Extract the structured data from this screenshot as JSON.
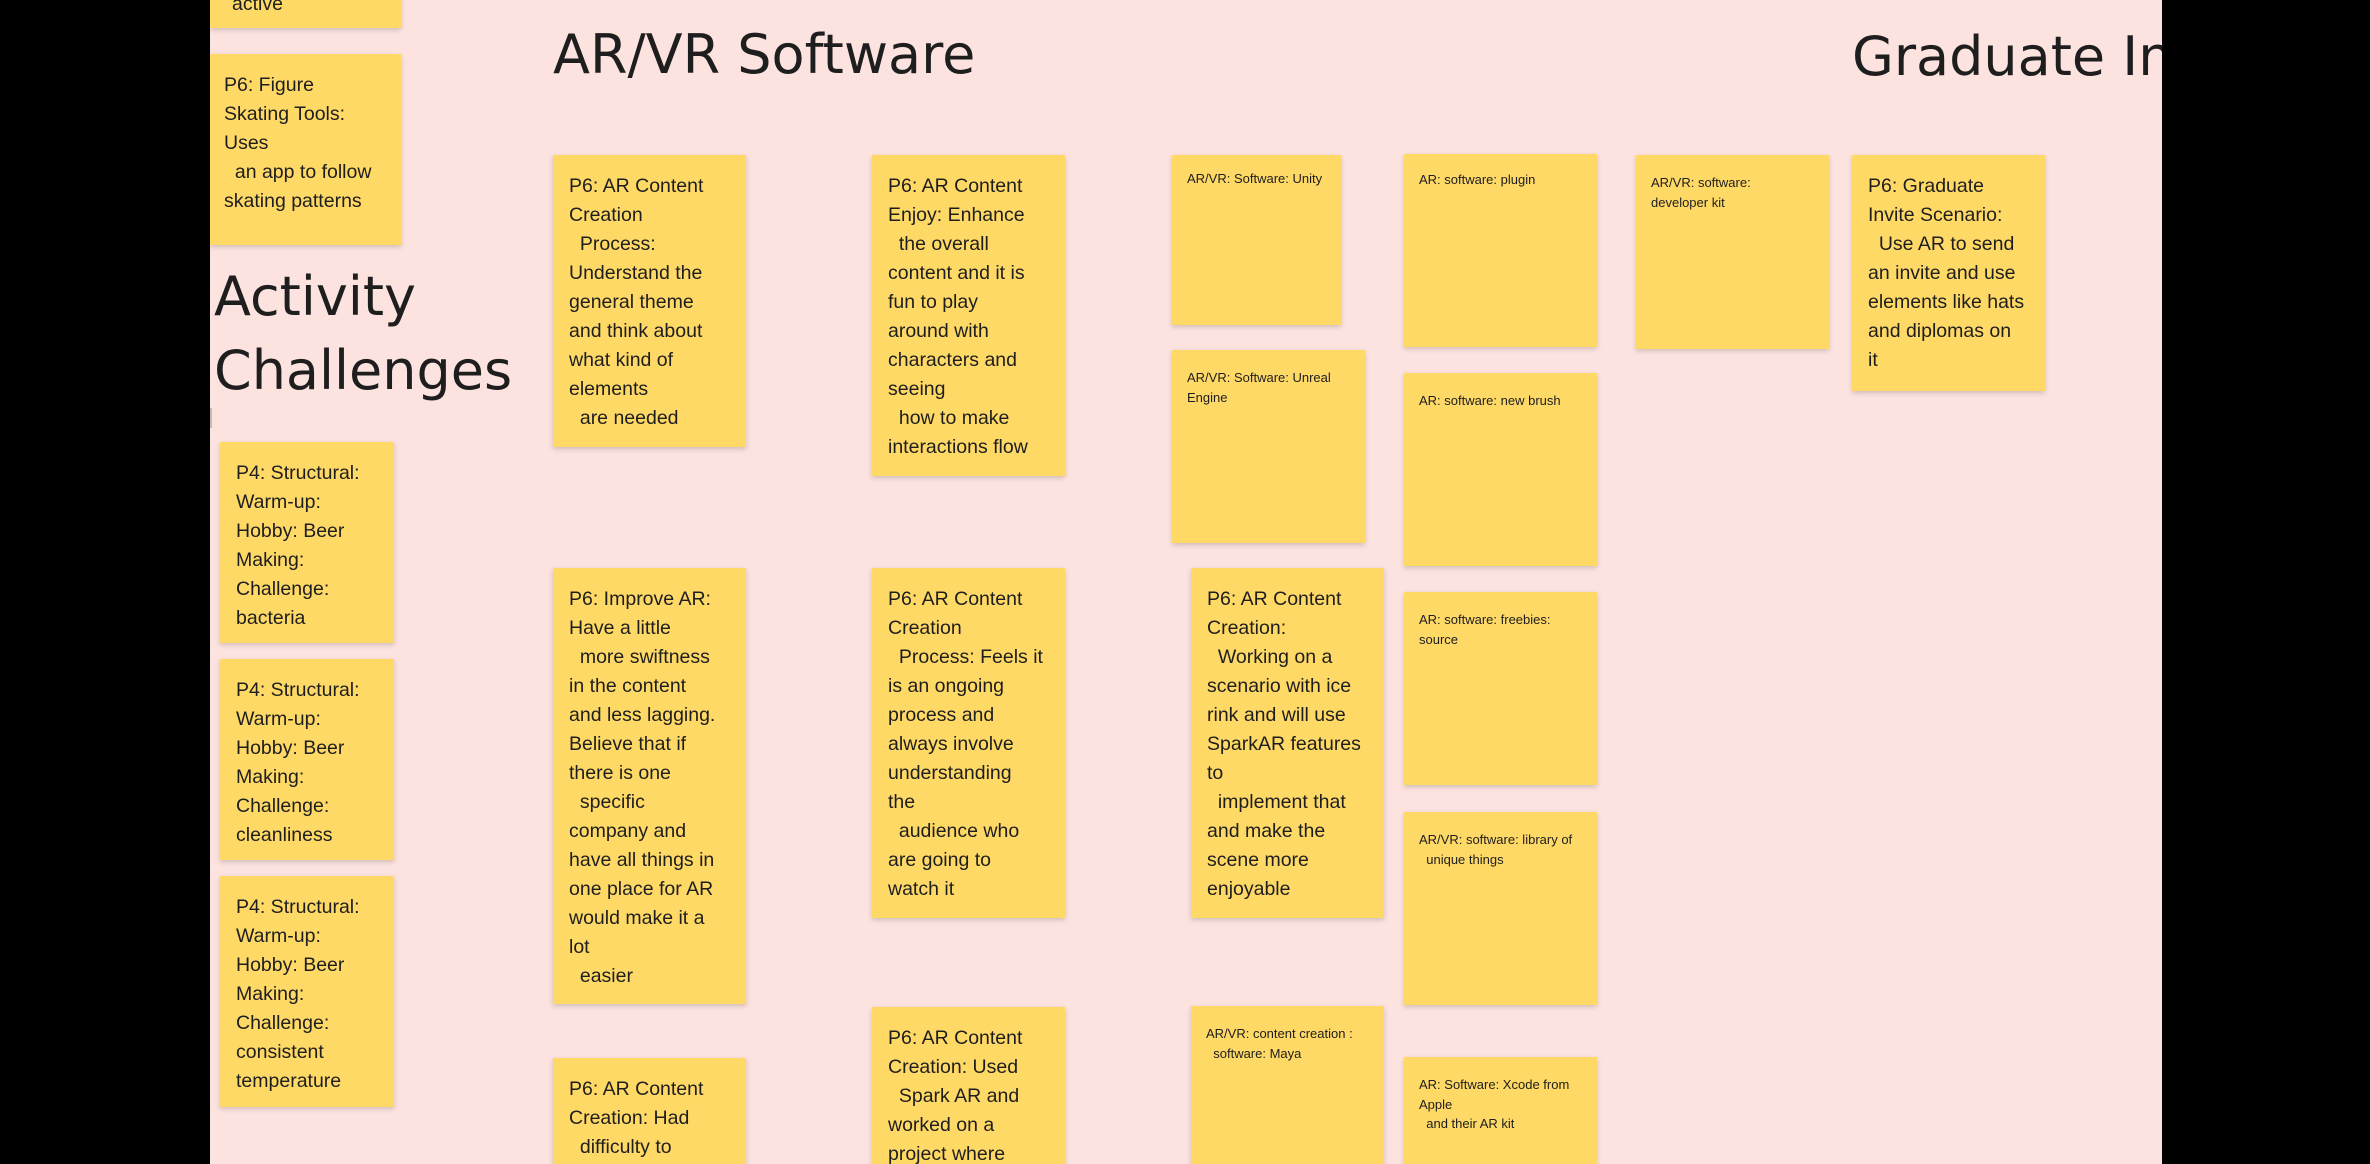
{
  "canvas": {
    "background": "#fde3df",
    "outside": "#000000",
    "sticky_color": "#ffd966"
  },
  "headings": {
    "arvr_software": "AR/VR Software",
    "activity_challenges": "Activity\nChallenges",
    "graduate_invite": "Graduate Invi"
  },
  "notes": {
    "active_partial": "active",
    "p6_figure_skating": "P6: Figure\nSkating Tools:\nUses\n  an app to follow\nskating patterns",
    "p4_bacteria": "P4: Structural:\nWarm-up:\nHobby: Beer\nMaking:\nChallenge:\nbacteria",
    "p4_cleanliness": "P4: Structural:\nWarm-up:\nHobby: Beer\nMaking:\nChallenge:\ncleanliness",
    "p4_temperature": "P4: Structural:\nWarm-up:\nHobby: Beer\nMaking:\nChallenge:\nconsistent\ntemperature",
    "p6_process_theme": "P6: AR Content\nCreation\n  Process:\nUnderstand the\ngeneral theme\nand think about\nwhat kind of\nelements\n  are needed",
    "p6_improve_ar": "P6: Improve AR:\nHave a little\n  more swiftness\nin the content\nand less lagging.\nBelieve that if\nthere is one\n  specific\ncompany and\nhave all things in\none place for AR\nwould make it a\nlot\n  easier",
    "p6_difficulty": "P6: AR Content\nCreation: Had\n  difficulty to",
    "p6_enjoy": "P6: AR Content\nEnjoy: Enhance\n  the overall\ncontent and it is\nfun to play\naround with\ncharacters and\nseeing\n  how to make\ninteractions flow",
    "p6_ongoing": "P6: AR Content\nCreation\n  Process: Feels it\nis an ongoing\nprocess and\nalways involve\nunderstanding\nthe\n  audience who\nare going to\nwatch it",
    "p6_spark_ar": "P6: AR Content\nCreation: Used\n  Spark AR and\nworked on a\nproject where",
    "unity": "AR/VR: Software: Unity",
    "unreal": "AR/VR: Software: Unreal\nEngine",
    "p6_ice_rink": "P6: AR Content\nCreation:\n  Working on a\nscenario with ice\nrink and will use\nSparkAR features\nto\n  implement that\nand make the\nscene more\nenjoyable",
    "maya": "AR/VR: content creation :\n  software: Maya",
    "plugin": "AR: software: plugin",
    "new_brush": "AR: software: new brush",
    "freebies": "AR: software: freebies:\nsource",
    "library": "AR/VR: software: library of\n  unique things",
    "xcode": "AR: Software: Xcode from\nApple\n  and their AR kit",
    "developer_kit": "AR/VR: software:\ndeveloper kit",
    "p6_graduate": "P6: Graduate\nInvite Scenario:\n  Use AR to send\nan invite and use\nelements like hats\nand diplomas on\nit"
  }
}
